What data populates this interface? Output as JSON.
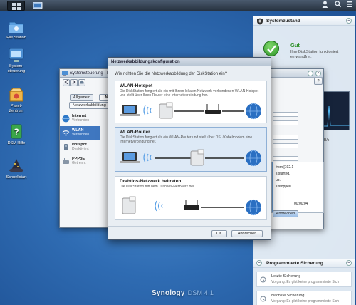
{
  "taskbar": {
    "icons": [
      "desktop-icon",
      "main-menu-icon"
    ],
    "right_icons": [
      "user-icon",
      "search-icon",
      "options-icon"
    ]
  },
  "desktop_icons": [
    {
      "label": "File Station",
      "icon": "folder-icon"
    },
    {
      "label": "System-\nsteuerung",
      "icon": "control-panel-icon"
    },
    {
      "label": "Paket-\nZentrum",
      "icon": "package-icon"
    },
    {
      "label": "DSM Hilfe",
      "icon": "help-icon"
    },
    {
      "label": "Schnellstart",
      "icon": "wizard-hat-icon"
    }
  ],
  "control_panel": {
    "title": "Systemsteuerung - N",
    "tabs": [
      "Allgemein",
      "Ne"
    ],
    "sub_tab": "Netzwerkabbildung",
    "items": [
      {
        "label": "Internet",
        "status": "Verbunden"
      },
      {
        "label": "WLAN",
        "status": "Verbunden"
      },
      {
        "label": "Hotspot",
        "status": "Deaktiviert"
      },
      {
        "label": "PPPoE",
        "status": "Getrennt"
      }
    ],
    "help": "?"
  },
  "bg_window": {
    "log_lines": [
      "from [192.1",
      "s started.",
      "up.",
      "s stopped."
    ],
    "time": "00:00:04",
    "cancel_label": "Abbrechen"
  },
  "dialog": {
    "title": "Netzwerkabbildungskonfiguration",
    "question": "Wie richten Sie die Netzwerkabbildung der DiskStation ein?",
    "options": [
      {
        "title": "WLAN-Hotspot",
        "desc": "Die DiskStation fungiert als ein mit Ihrem lokalen Netzwerk verbundenen WLAN-Hotspot und stellt über Ihren Router eine Internetverbindung her.",
        "selected": false
      },
      {
        "title": "WLAN-Router",
        "desc": "Die DiskStation fungiert als ein WLAN-Router und stellt über DSL/Kabelmodem eine Internetverbindung her.",
        "selected": true
      },
      {
        "title": "Drahtlos-Netzwerk beitreten",
        "desc": "Die DiskStation tritt dem Drahtlos-Netzwerk bei.",
        "selected": false
      }
    ],
    "ok_label": "OK",
    "cancel_label": "Abbrechen"
  },
  "system_health": {
    "title": "Systemzustand",
    "status": "Gut",
    "desc": "Ihre DiskStation funktioniert einwandfrei.",
    "cpu_unit": "B/s"
  },
  "backup": {
    "title": "Programmierte Sicherung",
    "last_title": "Letzte Sicherung",
    "last_desc": "Vorgang: Es gibt keine programmierte Sich",
    "next_title": "Nächste Sicherung",
    "next_desc": "Vorgang: Es gibt keine programmierte Sich"
  },
  "branding": {
    "logo": "Synology",
    "version": "DSM 4.1"
  },
  "colors": {
    "desktop": "#2f6cb3",
    "selected": "#dde9f6",
    "health_ok": "#3fae3a"
  }
}
